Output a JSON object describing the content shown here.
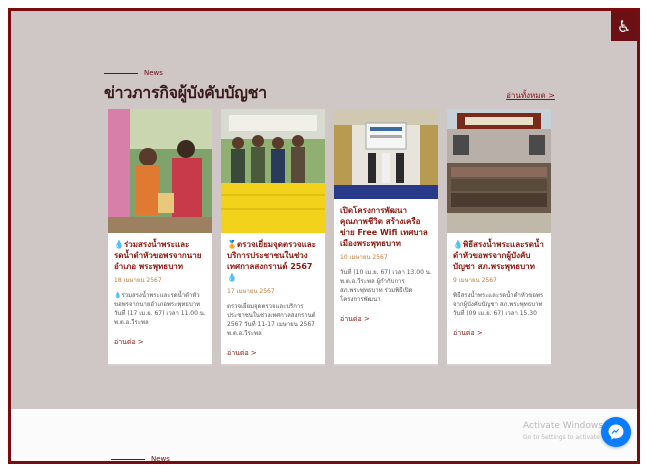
{
  "section": {
    "tag": "News",
    "heading": "ข่าวภารกิจผู้บังคับบัญชา",
    "read_all": "อ่านทั้งหมด >"
  },
  "cards": [
    {
      "title": "ร่วมสรงน้ำพระและรดน้ำดำหัวขอพรจากนายอำเภอ พระพุทธบาท",
      "date": "18 เมษายน 2567",
      "desc": "ร่วมสรงน้ำพระและรดน้ำดำหัวขอพรจากนายอำเภอพระพุทธบาท วันที่ (17 เม.ย. 67) เวลา 11.00 น. พ.ต.อ.วีระพล",
      "more": "อ่านต่อ >",
      "img_icon": "people-photo-icon"
    },
    {
      "title": "ตรวจเยี่ยมจุดตรวจและบริการประชาชนในช่วงเทศกาลสงกรานต์ 2567",
      "date": "17 เมษายน 2567",
      "desc": "ตรวจเยี่ยมจุดตรวจและบริการประชาชนในช่วงเทศกาลสงกรานต์ 2567 วันที่ 11-17 เมษายน 2567 พ.ต.อ.วีระพล",
      "more": "อ่านต่อ >",
      "img_icon": "checkpoint-photo-icon"
    },
    {
      "title": "เปิดโครงการพัฒนาคุณภาพชีวิต สร้างเครือข่าย Free Wifi เทศบาลเมืองพระพุทธบาท",
      "date": "10 เมษายน 2567",
      "desc": "วันที่ (10 เม.ย. 67) เวลา 13.00 น. พ.ต.อ.วีระพล ผู้กำกับการ สภ.พระพุทธบาท ร่วมพิธีเปิดโครงการพัฒนา",
      "more": "อ่านต่อ >",
      "img_icon": "ceremony-photo-icon"
    },
    {
      "title": "พิธีสรงน้ำพระและรดน้ำดำหัวขอพรจากผู้บังคับบัญชา สภ.พระพุทธบาท",
      "date": "9 เมษายน 2567",
      "desc": "พิธีสรงน้ำพระและรดน้ำดำหัวขอพรจากผู้บังคับบัญชา สภ.พระพุทธบาท วันที่ (09 เม.ย. 67) เวลา 15.30",
      "more": "อ่านต่อ >",
      "img_icon": "group-photo-icon"
    }
  ],
  "footer_section": {
    "tag": "News"
  },
  "watermark": {
    "line1": "Activate Windows",
    "line2": "Go to Settings to activate Windows."
  },
  "colors": {
    "brand": "#7a0c10",
    "accent": "#8b1a10",
    "messenger": "#0a7cff"
  }
}
